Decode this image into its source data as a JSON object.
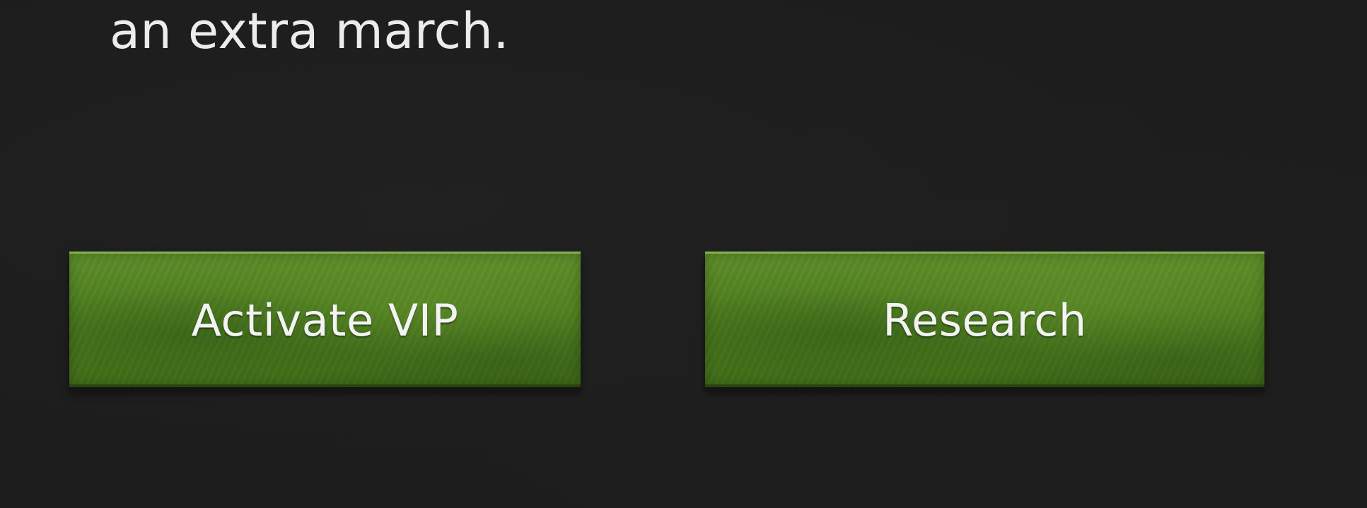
{
  "panel": {
    "description": "an extra march."
  },
  "actions": {
    "activate_vip_label": "Activate VIP",
    "research_label": "Research"
  },
  "colors": {
    "background": "#1d1d1d",
    "button_green": "#4f7f20",
    "button_highlight": "#86b04a",
    "text": "#ececec"
  }
}
